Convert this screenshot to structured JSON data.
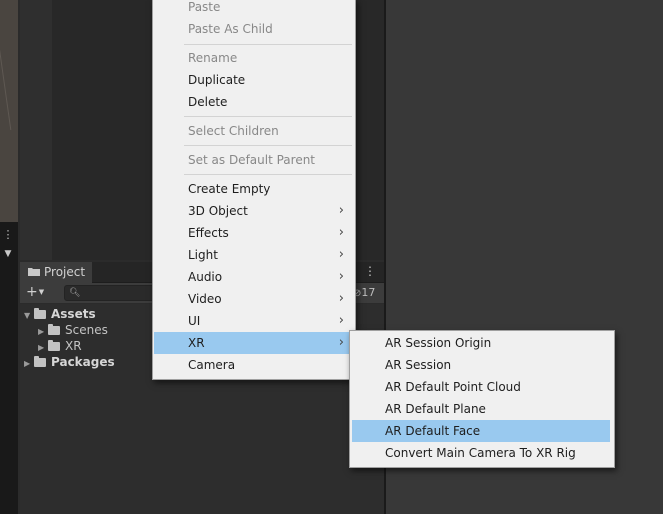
{
  "project_panel": {
    "tab_label": "Project",
    "create_button": "+",
    "hidden_count": "17",
    "tree": [
      {
        "label": "Assets",
        "bold": true,
        "expanded": true
      },
      {
        "label": "Scenes",
        "bold": false
      },
      {
        "label": "XR",
        "bold": false
      },
      {
        "label": "Packages",
        "bold": true,
        "expanded": false
      }
    ]
  },
  "context_menu": {
    "items": [
      {
        "label": "Paste",
        "disabled": true
      },
      {
        "label": "Paste As Child",
        "disabled": true
      },
      {
        "label": "Rename",
        "disabled": true
      },
      {
        "label": "Duplicate",
        "disabled": false
      },
      {
        "label": "Delete",
        "disabled": false
      },
      {
        "label": "Select Children",
        "disabled": true
      },
      {
        "label": "Set as Default Parent",
        "disabled": true
      },
      {
        "label": "Create Empty",
        "disabled": false
      },
      {
        "label": "3D Object",
        "disabled": false,
        "submenu": true
      },
      {
        "label": "Effects",
        "disabled": false,
        "submenu": true
      },
      {
        "label": "Light",
        "disabled": false,
        "submenu": true
      },
      {
        "label": "Audio",
        "disabled": false,
        "submenu": true
      },
      {
        "label": "Video",
        "disabled": false,
        "submenu": true
      },
      {
        "label": "UI",
        "disabled": false,
        "submenu": true
      },
      {
        "label": "XR",
        "disabled": false,
        "submenu": true,
        "highlighted": true
      },
      {
        "label": "Camera",
        "disabled": false
      }
    ]
  },
  "xr_submenu": {
    "items": [
      {
        "label": "AR Session Origin"
      },
      {
        "label": "AR Session"
      },
      {
        "label": "AR Default Point Cloud"
      },
      {
        "label": "AR Default Plane"
      },
      {
        "label": "AR Default Face",
        "highlighted": true
      },
      {
        "label": "Convert Main Camera To XR Rig"
      }
    ]
  },
  "colors": {
    "highlight": "#99c9ef",
    "menu_bg": "#f0f0f0",
    "panel_bg": "#2d2d2d"
  }
}
